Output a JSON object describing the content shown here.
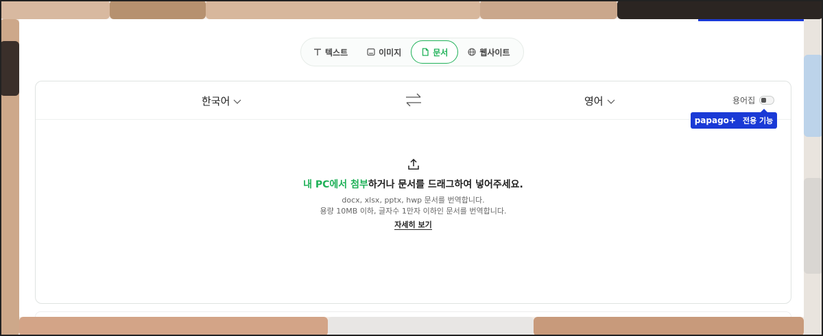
{
  "tabs": [
    {
      "label": "텍스트",
      "icon": "text-icon",
      "active": false
    },
    {
      "label": "이미지",
      "icon": "image-icon",
      "active": false
    },
    {
      "label": "문서",
      "icon": "document-icon",
      "active": true
    },
    {
      "label": "웹사이트",
      "icon": "globe-icon",
      "active": false
    }
  ],
  "translator": {
    "source_lang": "한국어",
    "target_lang": "영어",
    "glossary_label": "용어집",
    "badge": {
      "brand": "papago+",
      "text": "전용 기능"
    }
  },
  "upload": {
    "link_text": "내 PC에서 첨부",
    "main_text": "하거나 문서를 드래그하여 넣어주세요.",
    "formats_text": "docx, xlsx, pptx, hwp 문서를 번역합니다.",
    "limit_text": "용량 10MB 이하, 글자수 1만자 이하인 문서를 번역합니다.",
    "details_link": "자세히 보기"
  },
  "colors": {
    "accent_green": "#1fb158",
    "brand_blue": "#1a3ad6"
  }
}
